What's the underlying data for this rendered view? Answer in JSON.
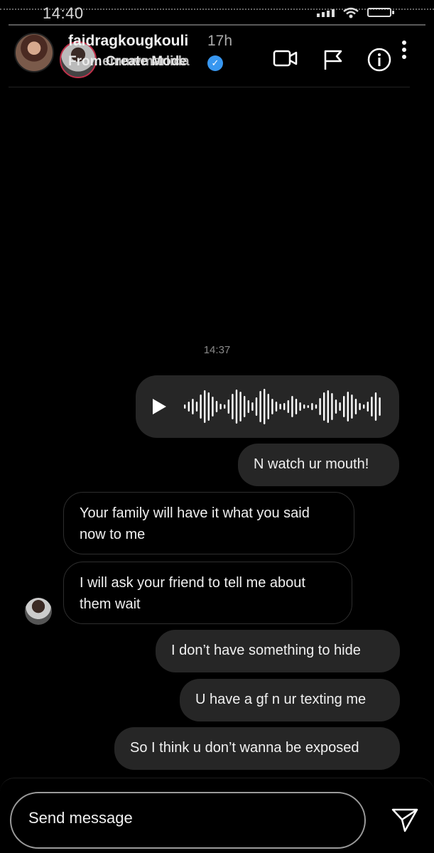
{
  "status_bar": {
    "time": "14:40"
  },
  "header": {
    "username": "faidragkougkouli",
    "time_ago": "17h",
    "sub_text_a": "From Create Mode",
    "sub_text_b": "emmvmarlida"
  },
  "chat": {
    "timestamp": "14:37",
    "messages": [
      {
        "direction": "out",
        "kind": "voice"
      },
      {
        "direction": "out",
        "text": "N watch ur mouth!"
      },
      {
        "direction": "in",
        "text": "Your family will have it what you said now to me"
      },
      {
        "direction": "in",
        "text": "I will ask your friend to tell me about them wait"
      },
      {
        "direction": "out",
        "text": "I don’t have something to hide"
      },
      {
        "direction": "out",
        "text": "U have a gf n ur texting me"
      },
      {
        "direction": "out",
        "text": "So I think u don’t wanna be exposed"
      }
    ]
  },
  "composer": {
    "placeholder": "Send message"
  },
  "icons": {
    "video": "video-camera-icon",
    "report": "flag-icon",
    "info": "info-icon",
    "more": "more-vertical-icon",
    "send": "send-paper-plane-icon",
    "play": "play-icon"
  },
  "colors": {
    "background": "#000000",
    "bubble": "#262626",
    "verified": "#3897f0",
    "story_ring": "#c0304a"
  }
}
